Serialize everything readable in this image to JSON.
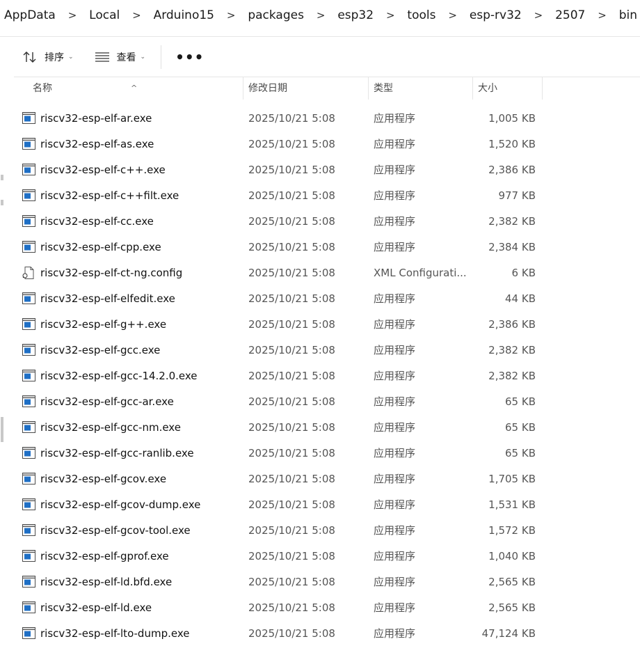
{
  "breadcrumb": [
    "AppData",
    "Local",
    "Arduino15",
    "packages",
    "esp32",
    "tools",
    "esp-rv32",
    "2507",
    "bin"
  ],
  "breadcrumb_separator": ">",
  "toolbar": {
    "sort_label": "排序",
    "view_label": "查看",
    "more_label": "•••"
  },
  "columns": {
    "name": "名称",
    "date": "修改日期",
    "type": "类型",
    "size": "大小",
    "sort_indicator": "^"
  },
  "files": [
    {
      "name": "riscv32-esp-elf-ar.exe",
      "date": "2025/10/21 5:08",
      "type": "应用程序",
      "size": "1,005 KB",
      "icon": "exe-icon"
    },
    {
      "name": "riscv32-esp-elf-as.exe",
      "date": "2025/10/21 5:08",
      "type": "应用程序",
      "size": "1,520 KB",
      "icon": "exe-icon"
    },
    {
      "name": "riscv32-esp-elf-c++.exe",
      "date": "2025/10/21 5:08",
      "type": "应用程序",
      "size": "2,386 KB",
      "icon": "exe-icon"
    },
    {
      "name": "riscv32-esp-elf-c++filt.exe",
      "date": "2025/10/21 5:08",
      "type": "应用程序",
      "size": "977 KB",
      "icon": "exe-icon"
    },
    {
      "name": "riscv32-esp-elf-cc.exe",
      "date": "2025/10/21 5:08",
      "type": "应用程序",
      "size": "2,382 KB",
      "icon": "exe-icon"
    },
    {
      "name": "riscv32-esp-elf-cpp.exe",
      "date": "2025/10/21 5:08",
      "type": "应用程序",
      "size": "2,384 KB",
      "icon": "exe-icon"
    },
    {
      "name": "riscv32-esp-elf-ct-ng.config",
      "date": "2025/10/21 5:08",
      "type": "XML Configurati...",
      "size": "6 KB",
      "icon": "config-file-icon"
    },
    {
      "name": "riscv32-esp-elf-elfedit.exe",
      "date": "2025/10/21 5:08",
      "type": "应用程序",
      "size": "44 KB",
      "icon": "exe-icon"
    },
    {
      "name": "riscv32-esp-elf-g++.exe",
      "date": "2025/10/21 5:08",
      "type": "应用程序",
      "size": "2,386 KB",
      "icon": "exe-icon"
    },
    {
      "name": "riscv32-esp-elf-gcc.exe",
      "date": "2025/10/21 5:08",
      "type": "应用程序",
      "size": "2,382 KB",
      "icon": "exe-icon"
    },
    {
      "name": "riscv32-esp-elf-gcc-14.2.0.exe",
      "date": "2025/10/21 5:08",
      "type": "应用程序",
      "size": "2,382 KB",
      "icon": "exe-icon"
    },
    {
      "name": "riscv32-esp-elf-gcc-ar.exe",
      "date": "2025/10/21 5:08",
      "type": "应用程序",
      "size": "65 KB",
      "icon": "exe-icon"
    },
    {
      "name": "riscv32-esp-elf-gcc-nm.exe",
      "date": "2025/10/21 5:08",
      "type": "应用程序",
      "size": "65 KB",
      "icon": "exe-icon"
    },
    {
      "name": "riscv32-esp-elf-gcc-ranlib.exe",
      "date": "2025/10/21 5:08",
      "type": "应用程序",
      "size": "65 KB",
      "icon": "exe-icon"
    },
    {
      "name": "riscv32-esp-elf-gcov.exe",
      "date": "2025/10/21 5:08",
      "type": "应用程序",
      "size": "1,705 KB",
      "icon": "exe-icon"
    },
    {
      "name": "riscv32-esp-elf-gcov-dump.exe",
      "date": "2025/10/21 5:08",
      "type": "应用程序",
      "size": "1,531 KB",
      "icon": "exe-icon"
    },
    {
      "name": "riscv32-esp-elf-gcov-tool.exe",
      "date": "2025/10/21 5:08",
      "type": "应用程序",
      "size": "1,572 KB",
      "icon": "exe-icon"
    },
    {
      "name": "riscv32-esp-elf-gprof.exe",
      "date": "2025/10/21 5:08",
      "type": "应用程序",
      "size": "1,040 KB",
      "icon": "exe-icon"
    },
    {
      "name": "riscv32-esp-elf-ld.bfd.exe",
      "date": "2025/10/21 5:08",
      "type": "应用程序",
      "size": "2,565 KB",
      "icon": "exe-icon"
    },
    {
      "name": "riscv32-esp-elf-ld.exe",
      "date": "2025/10/21 5:08",
      "type": "应用程序",
      "size": "2,565 KB",
      "icon": "exe-icon"
    },
    {
      "name": "riscv32-esp-elf-lto-dump.exe",
      "date": "2025/10/21 5:08",
      "type": "应用程序",
      "size": "47,124 KB",
      "icon": "exe-icon"
    }
  ],
  "colors": {
    "exe_icon_blue": "#1f6fc5",
    "text_primary": "#111111",
    "text_secondary": "#555555"
  }
}
